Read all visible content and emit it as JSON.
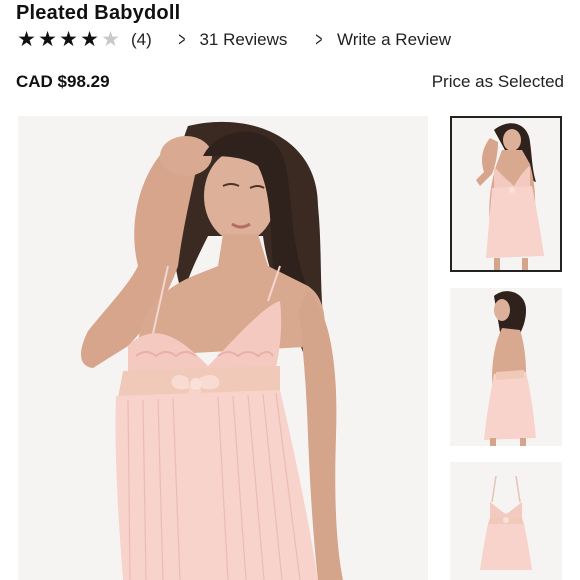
{
  "product": {
    "title": "Pleated Babydoll",
    "rating": 4,
    "rating_max": 5,
    "rating_count": "(4)",
    "reviews_link": "31 Reviews",
    "write_review_link": "Write a Review",
    "price": "CAD $98.29",
    "price_note": "Price as Selected"
  },
  "gallery": {
    "main_image": "model-front-photo",
    "thumbnails": [
      {
        "name": "front-view",
        "selected": true
      },
      {
        "name": "back-view",
        "selected": false
      },
      {
        "name": "flat-lay-view",
        "selected": false
      }
    ]
  },
  "colors": {
    "text": "#111111",
    "star_filled": "#111111",
    "star_empty": "#c9c9c9",
    "garment_pink": "#f7d3cb",
    "background": "#f5f3f2"
  }
}
